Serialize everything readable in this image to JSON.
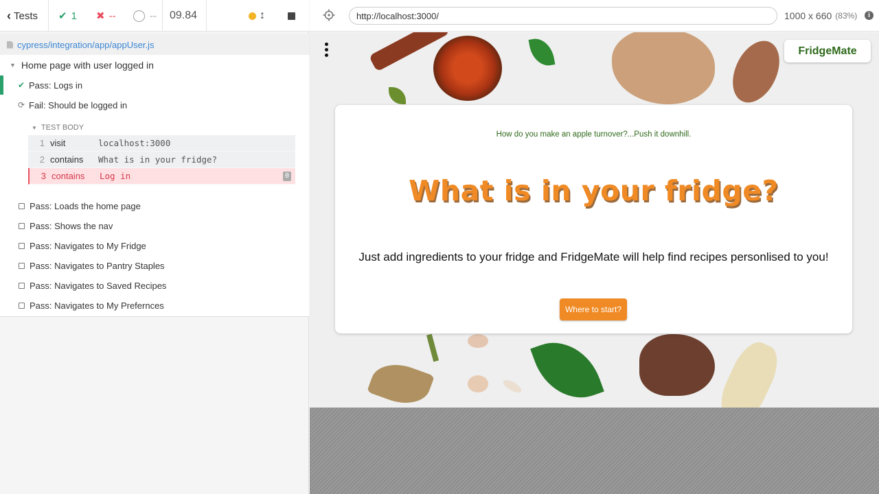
{
  "stats": {
    "tests_label": "Tests",
    "passed": "1",
    "failed": "--",
    "pending": "--",
    "duration": "09.84"
  },
  "spec": {
    "path": "cypress/integration/app/appUser.js"
  },
  "suite": {
    "title": "Home page with user logged in",
    "tests": [
      {
        "label": "Pass: Logs in",
        "state": "passed"
      },
      {
        "label": "Fail: Should be logged in",
        "state": "running"
      }
    ],
    "test_body_label": "TEST BODY",
    "commands": [
      {
        "num": "1",
        "name": "visit",
        "message": "localhost:3000"
      },
      {
        "num": "2",
        "name": "contains",
        "message": "What is in your fridge?"
      },
      {
        "num": "3",
        "name": "contains",
        "message": "Log in",
        "count": "0",
        "state": "failed"
      }
    ],
    "pending_tests": [
      "Pass: Loads the home page",
      "Pass: Shows the nav",
      "Pass: Navigates to My Fridge",
      "Pass: Navigates to Pantry Staples",
      "Pass: Navigates to Saved Recipes",
      "Pass: Navigates to My Prefernces"
    ]
  },
  "toolbar": {
    "url": "http://localhost:3000/",
    "viewport": "1000 x 660",
    "zoom": "(83%)"
  },
  "app": {
    "brand": "FridgeMate",
    "joke": "How do you make an apple turnover?...Push it downhill.",
    "title": "What is in your fridge?",
    "subtitle": "Just add ingredients to your fridge and FridgeMate will help find recipes personlised to you!",
    "cta": "Where to start?"
  },
  "colors": {
    "pass": "#2aa16c",
    "fail": "#e94f5f",
    "accent": "#f08a24",
    "brand_green": "#2e6a1b"
  }
}
